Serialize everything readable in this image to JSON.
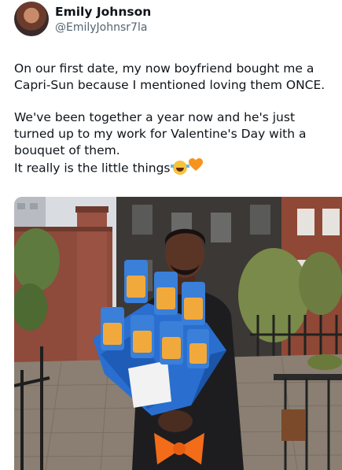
{
  "tweet": {
    "author": {
      "display_name": "Emily Johnson",
      "handle": "@EmilyJohnsr7la",
      "avatar_icon": "profile-avatar"
    },
    "paragraphs": [
      "On our first date, my now boyfriend bought me a Capri-Sun because I mentioned loving them ONCE.",
      "We've been together a year now and he's just turned up to my work for Valentine's Day with a bouquet of them.",
      "It really is the little things"
    ],
    "emojis": [
      "laughing-with-tears-icon",
      "orange-heart-icon"
    ],
    "media": {
      "description_icon": "photo-man-with-capri-sun-bouquet"
    }
  },
  "colors": {
    "text_primary": "#0f1419",
    "text_secondary": "#536471",
    "heart": "#f7941d",
    "bouquet_wrap": "#2a6fd0"
  }
}
